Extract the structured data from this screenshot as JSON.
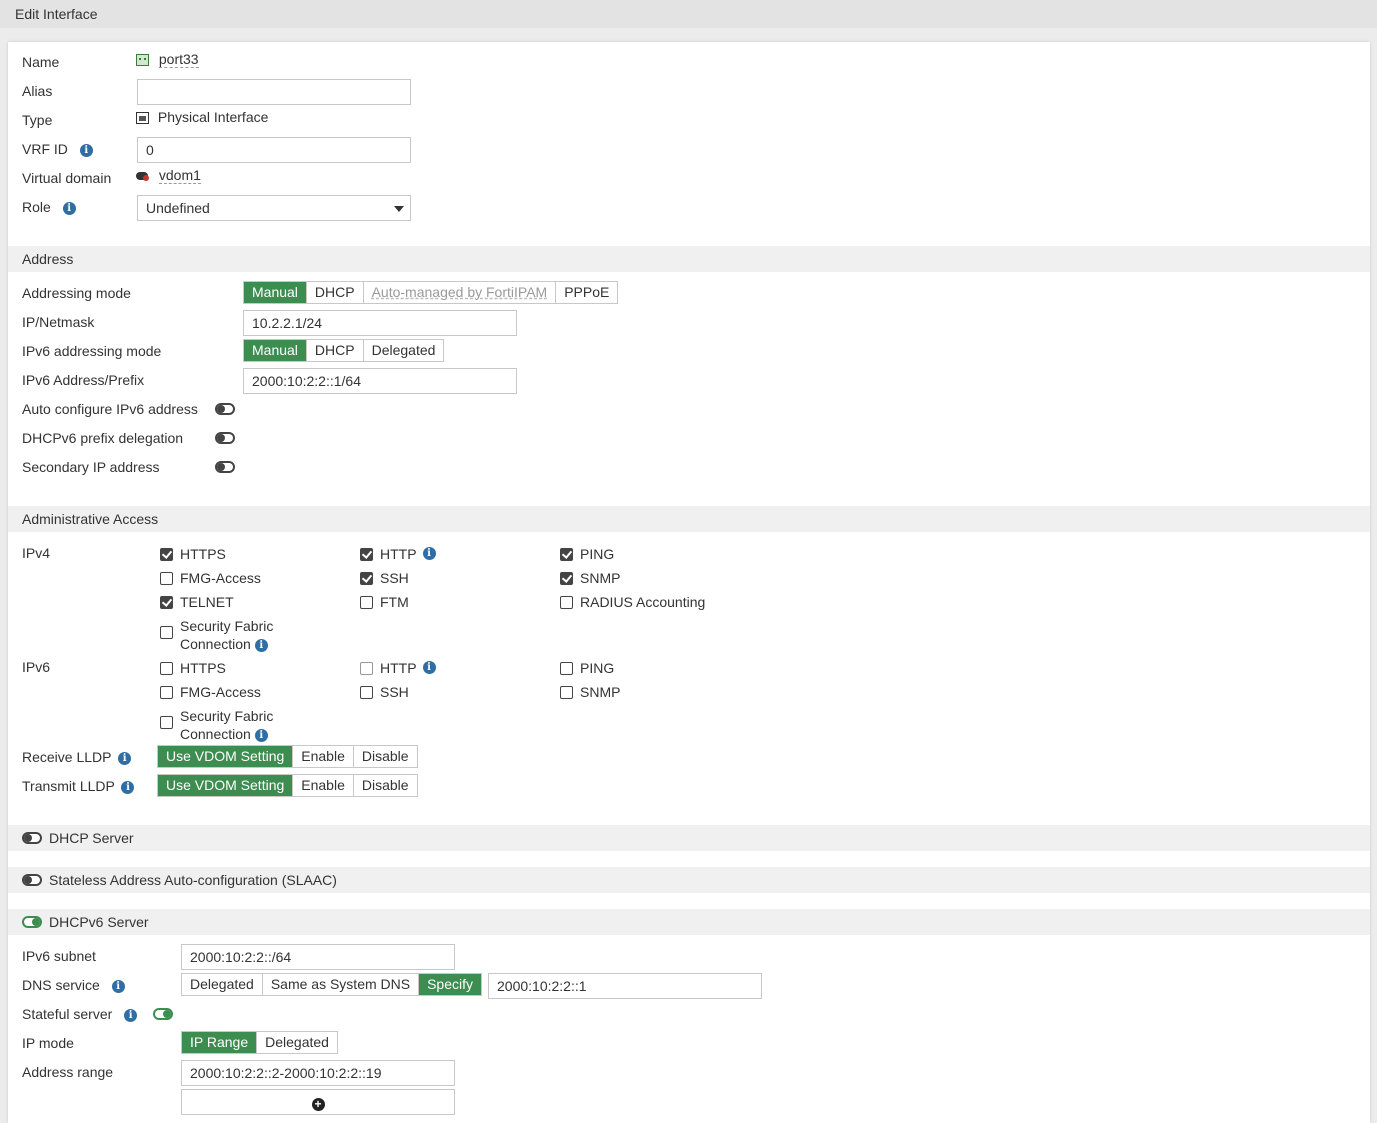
{
  "window": {
    "title": "Edit Interface"
  },
  "general": {
    "name_label": "Name",
    "name_value": "port33",
    "alias_label": "Alias",
    "alias_value": "",
    "type_label": "Type",
    "type_value": "Physical Interface",
    "vrf_label": "VRF ID",
    "vrf_value": "0",
    "vdom_label": "Virtual domain",
    "vdom_value": "vdom1",
    "role_label": "Role",
    "role_value": "Undefined"
  },
  "address": {
    "section_title": "Address",
    "mode_label": "Addressing mode",
    "mode_options": [
      "Manual",
      "DHCP",
      "Auto-managed by FortiIPAM",
      "PPPoE"
    ],
    "mode_selected": "Manual",
    "ipnetmask_label": "IP/Netmask",
    "ipnetmask_value": "10.2.2.1/24",
    "ipv6_mode_label": "IPv6 addressing mode",
    "ipv6_mode_options": [
      "Manual",
      "DHCP",
      "Delegated"
    ],
    "ipv6_prefix_label": "IPv6 Address/Prefix",
    "ipv6_prefix_value": "2000:10:2:2::1/64",
    "auto_config_label": "Auto configure IPv6 address",
    "auto_config_on": false,
    "dhcpv6_pd_label": "DHCPv6 prefix delegation",
    "dhcpv6_pd_on": false,
    "secondary_label": "Secondary IP address",
    "secondary_on": false
  },
  "admin": {
    "section_title": "Administrative Access",
    "ipv4_label": "IPv4",
    "ipv4": [
      {
        "label": "HTTPS",
        "checked": true
      },
      {
        "label": "HTTP",
        "checked": true
      },
      {
        "label": "PING",
        "checked": true
      },
      {
        "label": "FMG-Access",
        "checked": false
      },
      {
        "label": "SSH",
        "checked": true
      },
      {
        "label": "SNMP",
        "checked": true
      },
      {
        "label": "TELNET",
        "checked": true
      },
      {
        "label": "FTM",
        "checked": false
      },
      {
        "label": "RADIUS Accounting",
        "checked": false
      },
      {
        "label": "Security Fabric",
        "label2": "Connection",
        "checked": false
      }
    ],
    "ipv6_label": "IPv6",
    "ipv6": [
      {
        "label": "HTTPS",
        "checked": false
      },
      {
        "label": "HTTP",
        "checked": false
      },
      {
        "label": "PING",
        "checked": false
      },
      {
        "label": "FMG-Access",
        "checked": false
      },
      {
        "label": "SSH",
        "checked": false
      },
      {
        "label": "SNMP",
        "checked": false
      },
      {
        "label": "Security Fabric",
        "label2": "Connection",
        "checked": false
      }
    ],
    "receive_lldp_label": "Receive LLDP",
    "transmit_lldp_label": "Transmit LLDP",
    "lldp_options": [
      "Use VDOM Setting",
      "Enable",
      "Disable"
    ]
  },
  "dhcp_server": {
    "title": "DHCP Server",
    "on": false
  },
  "slaac": {
    "title": "Stateless Address Auto-configuration (SLAAC)",
    "on": false
  },
  "dhcpv6": {
    "title": "DHCPv6 Server",
    "on": true,
    "subnet_label": "IPv6 subnet",
    "subnet_value": "2000:10:2:2::/64",
    "dns_label": "DNS service",
    "dns_options": [
      "Delegated",
      "Same as System DNS",
      "Specify"
    ],
    "dns_value": "2000:10:2:2::1",
    "stateful_label": "Stateful server",
    "stateful_on": true,
    "ipmode_label": "IP mode",
    "ipmode_options": [
      "IP Range",
      "Delegated"
    ],
    "range_label": "Address range",
    "range_value": "2000:10:2:2::2-2000:10:2:2::19"
  },
  "colors": {
    "accent": "#3c8d4f",
    "info": "#2f6ea5"
  }
}
